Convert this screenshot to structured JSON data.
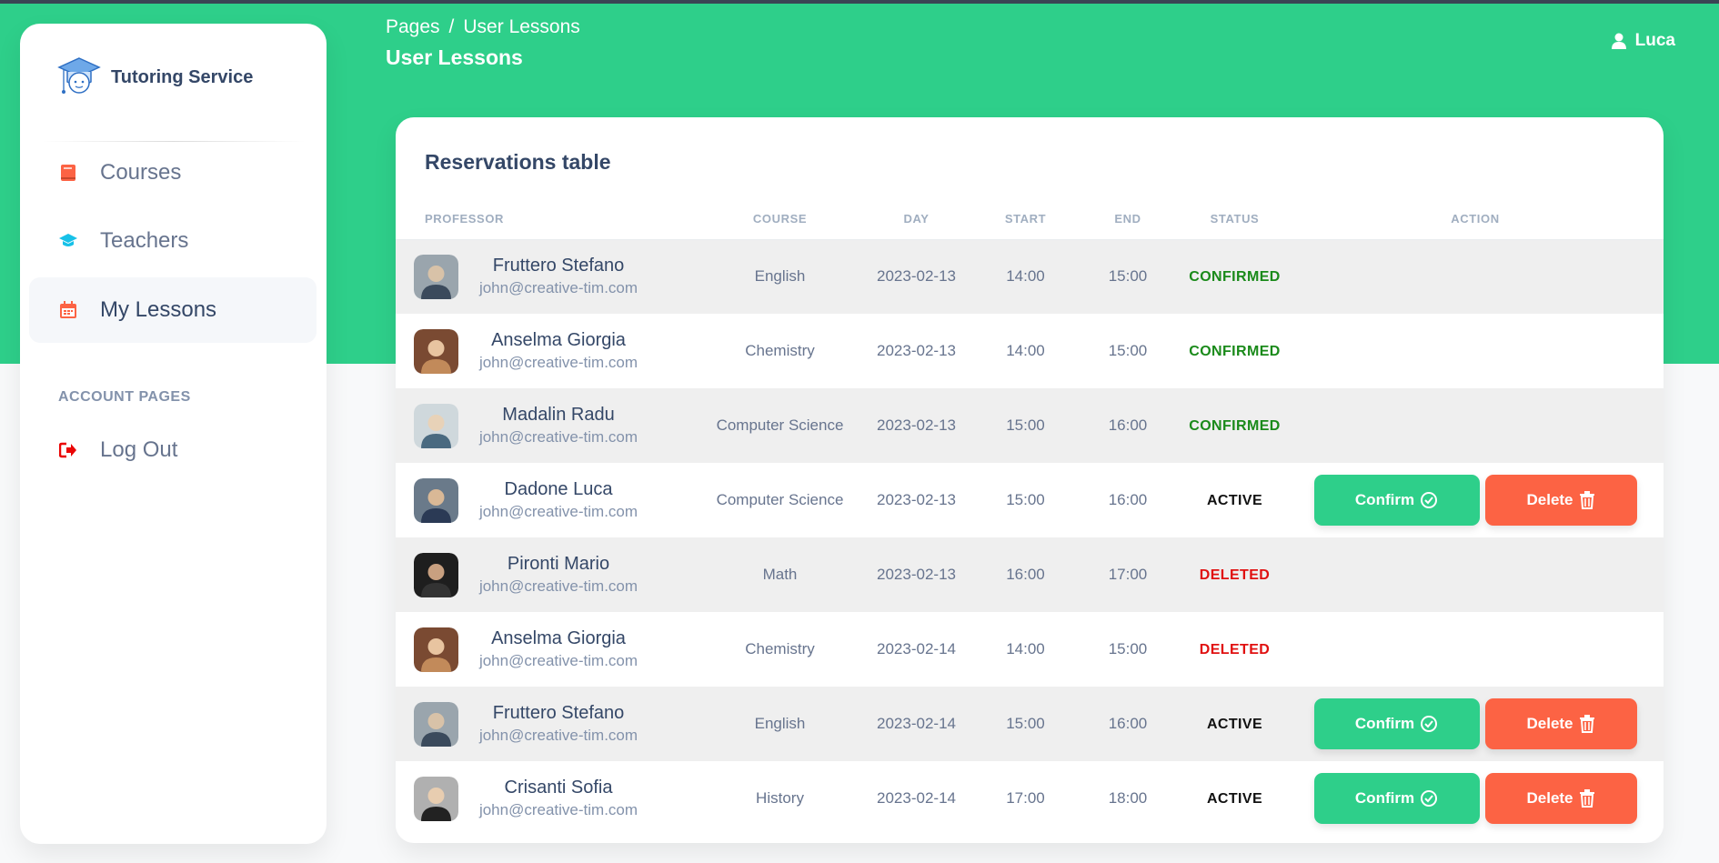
{
  "brand": {
    "title": "Tutoring Service"
  },
  "sidebar": {
    "items": [
      {
        "label": "Courses",
        "icon": "book-icon",
        "color": "#fc6344",
        "active": false
      },
      {
        "label": "Teachers",
        "icon": "graduation-cap-icon",
        "color": "#17c1e8",
        "active": false
      },
      {
        "label": "My Lessons",
        "icon": "calendar-icon",
        "color": "#fc6344",
        "active": true
      }
    ],
    "section_title": "ACCOUNT PAGES",
    "account_items": [
      {
        "label": "Log Out",
        "icon": "logout-icon",
        "color": "#ea0606"
      }
    ]
  },
  "header": {
    "breadcrumb": [
      "Pages",
      "User Lessons"
    ],
    "breadcrumb_sep": "/",
    "title": "User Lessons",
    "user": "Luca"
  },
  "table": {
    "title": "Reservations table",
    "columns": [
      "PROFESSOR",
      "COURSE",
      "DAY",
      "START",
      "END",
      "STATUS",
      "ACTION"
    ],
    "confirm_label": "Confirm",
    "delete_label": "Delete",
    "status_colors": {
      "CONFIRMED": "#1a8a1a",
      "ACTIVE": "#111111",
      "DELETED": "#e01010"
    },
    "rows": [
      {
        "name": "Fruttero Stefano",
        "email": "john@creative-tim.com",
        "course": "English",
        "day": "2023-02-13",
        "start": "14:00",
        "end": "15:00",
        "status": "CONFIRMED",
        "actions": false
      },
      {
        "name": "Anselma Giorgia",
        "email": "john@creative-tim.com",
        "course": "Chemistry",
        "day": "2023-02-13",
        "start": "14:00",
        "end": "15:00",
        "status": "CONFIRMED",
        "actions": false
      },
      {
        "name": "Madalin Radu",
        "email": "john@creative-tim.com",
        "course": "Computer Science",
        "day": "2023-02-13",
        "start": "15:00",
        "end": "16:00",
        "status": "CONFIRMED",
        "actions": false
      },
      {
        "name": "Dadone Luca",
        "email": "john@creative-tim.com",
        "course": "Computer Science",
        "day": "2023-02-13",
        "start": "15:00",
        "end": "16:00",
        "status": "ACTIVE",
        "actions": true
      },
      {
        "name": "Pironti Mario",
        "email": "john@creative-tim.com",
        "course": "Math",
        "day": "2023-02-13",
        "start": "16:00",
        "end": "17:00",
        "status": "DELETED",
        "actions": false
      },
      {
        "name": "Anselma Giorgia",
        "email": "john@creative-tim.com",
        "course": "Chemistry",
        "day": "2023-02-14",
        "start": "14:00",
        "end": "15:00",
        "status": "DELETED",
        "actions": false
      },
      {
        "name": "Fruttero Stefano",
        "email": "john@creative-tim.com",
        "course": "English",
        "day": "2023-02-14",
        "start": "15:00",
        "end": "16:00",
        "status": "ACTIVE",
        "actions": true
      },
      {
        "name": "Crisanti Sofia",
        "email": "john@creative-tim.com",
        "course": "History",
        "day": "2023-02-14",
        "start": "17:00",
        "end": "18:00",
        "status": "ACTIVE",
        "actions": true
      }
    ]
  }
}
